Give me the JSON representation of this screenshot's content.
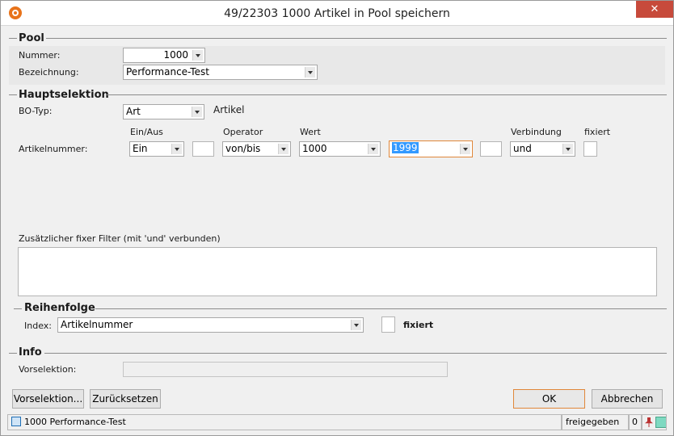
{
  "window": {
    "title": "49/22303 1000 Artikel in Pool speichern",
    "close_glyph": "✕"
  },
  "pool": {
    "heading": "Pool",
    "nummer_label": "Nummer:",
    "nummer_value": "1000",
    "bezeichnung_label": "Bezeichnung:",
    "bezeichnung_value": "Performance-Test"
  },
  "hauptselektion": {
    "heading": "Hauptselektion",
    "bo_typ_label": "BO-Typ:",
    "bo_typ_value": "Art",
    "bo_typ_text": "Artikel",
    "col_ein_aus": "Ein/Aus",
    "col_operator": "Operator",
    "col_wert": "Wert",
    "col_verbindung": "Verbindung",
    "col_fixiert": "fixiert",
    "row_label": "Artikelnummer:",
    "ein_aus_value": "Ein",
    "operator_value": "von/bis",
    "wert_from": "1000",
    "wert_to": "1999",
    "verbindung_value": "und"
  },
  "filter": {
    "label": "Zusätzlicher fixer Filter (mit 'und' verbunden)"
  },
  "reihenfolge": {
    "heading": "Reihenfolge",
    "index_label": "Index:",
    "index_value": "Artikelnummer",
    "fixiert_label": "fixiert"
  },
  "info": {
    "heading": "Info",
    "vorselektion_label": "Vorselektion:"
  },
  "buttons": {
    "vorselektion": "Vorselektion...",
    "zuruecksetzen": "Zurücksetzen",
    "ok": "OK",
    "abbrechen": "Abbrechen"
  },
  "status": {
    "record": "1000 Performance-Test",
    "state": "freigegeben",
    "count": "0"
  },
  "icons": {
    "app": "app-logo-icon",
    "status": "record-icon",
    "pin": "pin-icon",
    "note": "note-icon"
  }
}
